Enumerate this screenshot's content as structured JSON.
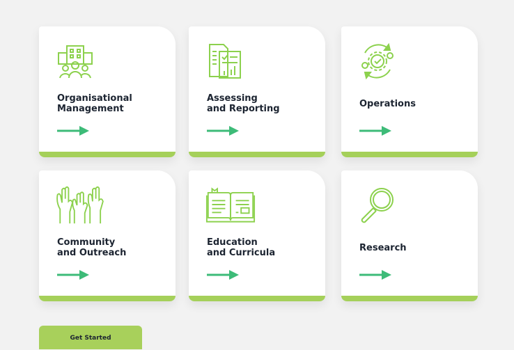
{
  "colors": {
    "accent": "#a5d05a",
    "arrow": "#3dbb78",
    "icon": "#8cd14d",
    "text": "#1c2431"
  },
  "cards": [
    {
      "title": "Organisational\nManagement",
      "icon": "building-people-icon"
    },
    {
      "title": "Assessing\nand Reporting",
      "icon": "report-documents-icon"
    },
    {
      "title": "Operations",
      "icon": "gears-cycle-icon"
    },
    {
      "title": "Community\nand Outreach",
      "icon": "raised-hands-icon"
    },
    {
      "title": "Education\nand Curricula",
      "icon": "open-book-icon"
    },
    {
      "title": "Research",
      "icon": "magnifier-icon"
    }
  ],
  "cta": {
    "label": "Get Started"
  }
}
